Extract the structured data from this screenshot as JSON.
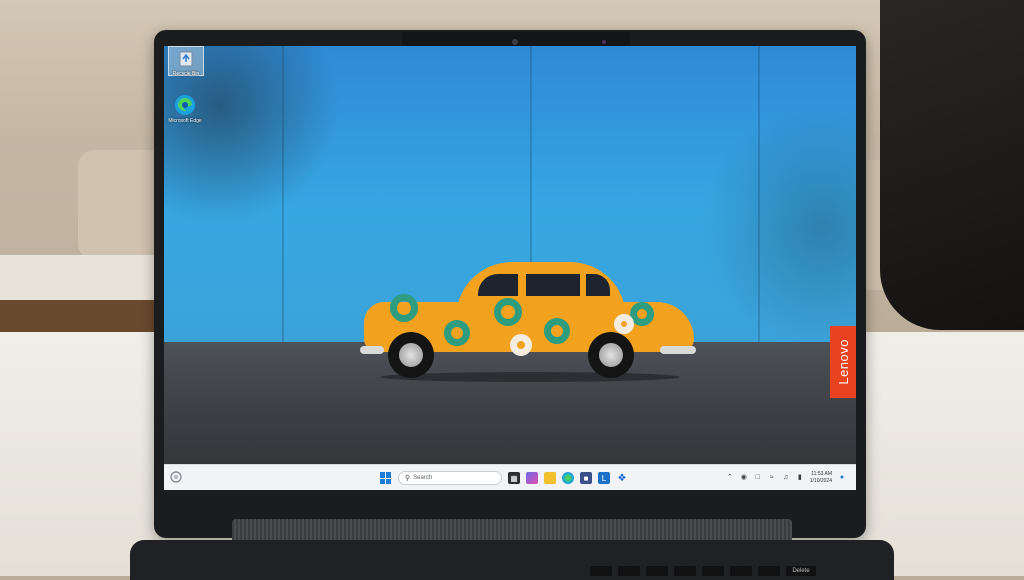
{
  "brand": {
    "label": "Lenovo",
    "color": "#e8421e"
  },
  "desktop": {
    "icons": [
      {
        "name": "recycle-bin",
        "label": "Recycle Bin"
      },
      {
        "name": "microsoft-edge",
        "label": "Microsoft Edge"
      }
    ]
  },
  "taskbar": {
    "search_placeholder": "Search",
    "apps": [
      "task-view",
      "copilot",
      "file-explorer",
      "edge",
      "store",
      "lenovo-app",
      "dropbox"
    ],
    "tray_icons": [
      "chevron-up",
      "wifi",
      "speaker",
      "battery"
    ],
    "clock": {
      "time": "11:53 AM",
      "date": "1/10/2024"
    }
  },
  "keyboard": {
    "visible_key": "Delete"
  },
  "colors": {
    "accent": "#1d7cd6",
    "wall": "#37a7e3",
    "car": "#f3a21f"
  }
}
